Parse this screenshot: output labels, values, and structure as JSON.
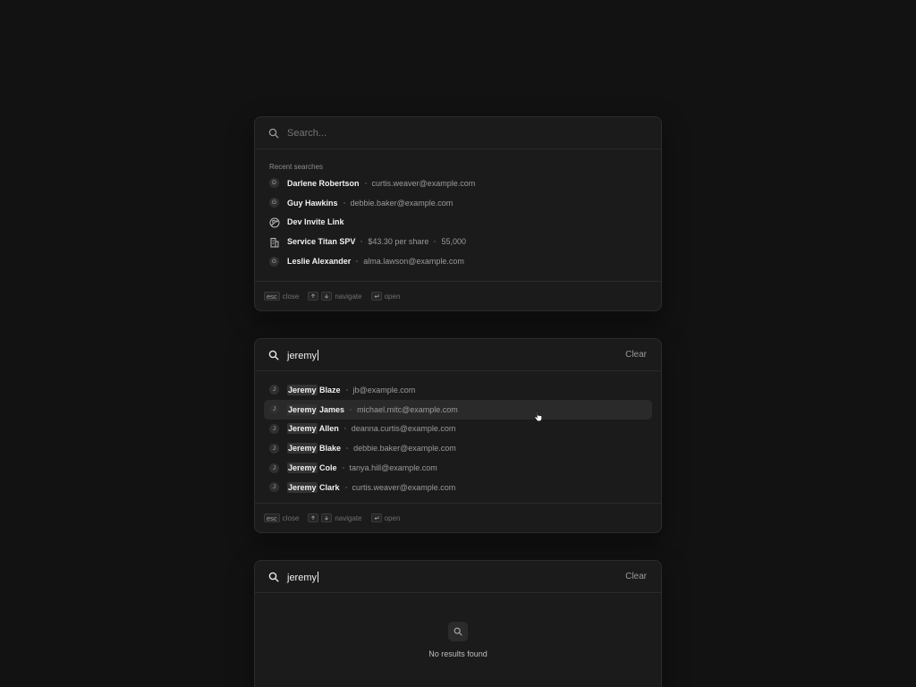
{
  "recent": {
    "search_placeholder": "Search...",
    "section_label": "Recent searches",
    "items": [
      {
        "badge": "D",
        "title": "Darlene Robertson",
        "sub": [
          "curtis.weaver@example.com"
        ]
      },
      {
        "badge": "G",
        "title": "Guy Hawkins",
        "sub": [
          "debbie.baker@example.com"
        ]
      },
      {
        "icon": "user-link-icon",
        "title": "Dev Invite Link",
        "sub": []
      },
      {
        "icon": "building-icon",
        "title": "Service Titan SPV",
        "sub": [
          "$43.30 per share",
          "55,000"
        ]
      },
      {
        "badge": "G",
        "title": "Leslie Alexander",
        "sub": [
          "alma.lawson@example.com"
        ]
      }
    ]
  },
  "results": {
    "query": "jeremy",
    "clear_label": "Clear",
    "highlight_index": 1,
    "items": [
      {
        "badge": "J",
        "match": "Jeremy",
        "rest": " Blaze",
        "email": "jb@example.com"
      },
      {
        "badge": "J",
        "match": "Jeremy",
        "rest": " James",
        "email": "michael.mitc@example.com"
      },
      {
        "badge": "J",
        "match": "Jeremy",
        "rest": " Allen",
        "email": "deanna.curtis@example.com"
      },
      {
        "badge": "J",
        "match": "Jeremy",
        "rest": " Blake",
        "email": "debbie.baker@example.com"
      },
      {
        "badge": "J",
        "match": "Jeremy",
        "rest": " Cole",
        "email": "tanya.hill@example.com"
      },
      {
        "badge": "J",
        "match": "Jeremy",
        "rest": " Clark",
        "email": "curtis.weaver@example.com"
      }
    ]
  },
  "empty": {
    "query": "jeremy",
    "clear_label": "Clear",
    "message": "No results found"
  },
  "footer": {
    "esc_key": "esc",
    "close_label": "close",
    "navigate_label": "navigate",
    "open_label": "open"
  }
}
